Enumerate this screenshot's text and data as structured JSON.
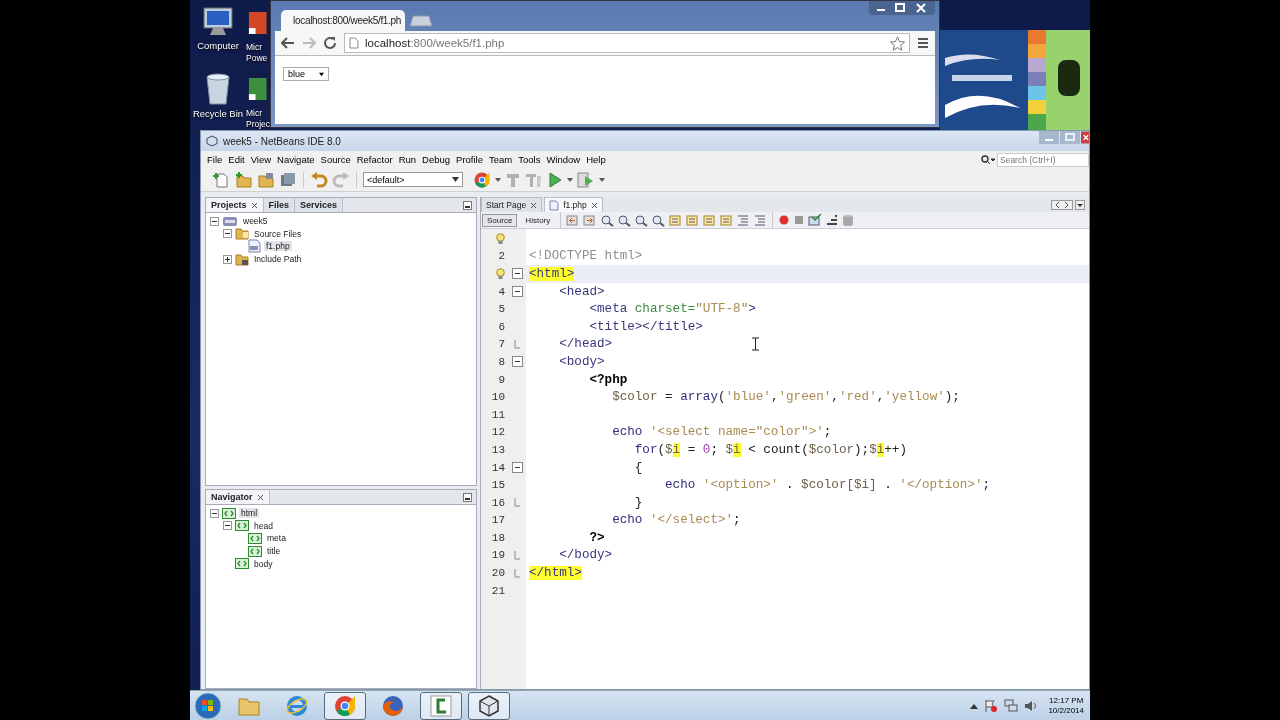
{
  "desktop": {
    "icons": [
      {
        "kind": "computer",
        "label": "Computer"
      },
      {
        "kind": "powerpoint",
        "label": "Micr Powe"
      },
      {
        "kind": "recycle",
        "label": "Recycle Bin"
      },
      {
        "kind": "project",
        "label": "Micr Projec"
      }
    ]
  },
  "browser": {
    "tab": {
      "title": "localhost:800/week5/f1.ph",
      "selected": true
    },
    "address": {
      "host": "localhost",
      "rest": ":800/week5/f1.php"
    },
    "select": {
      "value": "blue"
    }
  },
  "ide": {
    "title": "week5 - NetBeans IDE 8.0",
    "menu": [
      "File",
      "Edit",
      "View",
      "Navigate",
      "Source",
      "Refactor",
      "Run",
      "Debug",
      "Profile",
      "Team",
      "Tools",
      "Window",
      "Help"
    ],
    "search": {
      "placeholder": "Search (Ctrl+I)"
    },
    "config": "<default>",
    "projects": {
      "tabs": [
        {
          "label": "Projects",
          "selected": true
        },
        {
          "label": "Files",
          "selected": false
        },
        {
          "label": "Services",
          "selected": false
        }
      ],
      "tree": [
        {
          "label": "week5",
          "kind": "project",
          "expanded": true,
          "selected": false,
          "children": [
            {
              "label": "Source Files",
              "kind": "folder",
              "expanded": true,
              "selected": false,
              "children": [
                {
                  "label": "f1.php",
                  "kind": "file",
                  "selected": true
                }
              ]
            },
            {
              "label": "Include Path",
              "kind": "library",
              "expanded": false,
              "selected": false
            }
          ]
        }
      ]
    },
    "navigator": {
      "title": "Navigator",
      "tree": [
        {
          "label": "html",
          "kind": "tag",
          "expanded": true,
          "selected": true,
          "children": [
            {
              "label": "head",
              "kind": "tag",
              "expanded": true,
              "selected": false,
              "children": [
                {
                  "label": "meta",
                  "kind": "tag",
                  "selected": false
                },
                {
                  "label": "title",
                  "kind": "tag",
                  "selected": false
                }
              ]
            },
            {
              "label": "body",
              "kind": "tag",
              "selected": false
            }
          ]
        }
      ]
    },
    "editor": {
      "tabs": [
        {
          "label": "Start Page",
          "selected": false
        },
        {
          "label": "f1.php",
          "selected": true
        }
      ],
      "views": [
        {
          "label": "Source",
          "selected": true
        },
        {
          "label": "History",
          "selected": false
        }
      ],
      "lines": [
        {
          "hint": true
        },
        {
          "n": "2",
          "tokens": [
            {
              "kind": "doctype",
              "s": "<!DOCTYPE html>"
            }
          ]
        },
        {
          "hint": true,
          "current": true,
          "fold_open": true,
          "tokens": [
            {
              "kind": "tag",
              "s": "<html>",
              "hl": true
            }
          ]
        },
        {
          "n": "4",
          "fold_open": true,
          "tokens": [
            {
              "kind": "tag",
              "s": "    <head>"
            }
          ]
        },
        {
          "n": "5",
          "tokens": [
            {
              "kind": "tag",
              "s": "        <meta "
            },
            {
              "kind": "attr",
              "s": "charset="
            },
            {
              "kind": "str",
              "s": "\"UTF-8\""
            },
            {
              "kind": "tag",
              "s": ">"
            }
          ]
        },
        {
          "n": "6",
          "tokens": [
            {
              "kind": "tag",
              "s": "        <title></title>"
            }
          ]
        },
        {
          "n": "7",
          "fold_end": true,
          "tokens": [
            {
              "kind": "tag",
              "s": "    </head>"
            }
          ]
        },
        {
          "n": "8",
          "fold_open": true,
          "tokens": [
            {
              "kind": "tag",
              "s": "    <body>"
            }
          ]
        },
        {
          "n": "9",
          "tokens": [
            {
              "kind": "php",
              "s": "        <?php"
            }
          ]
        },
        {
          "n": "10",
          "tokens": [
            {
              "kind": "var",
              "s": "           $color"
            },
            {
              "kind": "plain",
              "s": " = "
            },
            {
              "kind": "kw",
              "s": "array"
            },
            {
              "kind": "plain",
              "s": "("
            },
            {
              "kind": "str",
              "s": "'blue'"
            },
            {
              "kind": "plain",
              "s": ","
            },
            {
              "kind": "str",
              "s": "'green'"
            },
            {
              "kind": "plain",
              "s": ","
            },
            {
              "kind": "str",
              "s": "'red'"
            },
            {
              "kind": "plain",
              "s": ","
            },
            {
              "kind": "str",
              "s": "'yellow'"
            },
            {
              "kind": "plain",
              "s": ");"
            }
          ]
        },
        {
          "n": "11"
        },
        {
          "n": "12",
          "tokens": [
            {
              "kind": "kw",
              "s": "           echo "
            },
            {
              "kind": "str",
              "s": "'<select name=\"color\">'"
            },
            {
              "kind": "plain",
              "s": ";"
            }
          ]
        },
        {
          "n": "13",
          "tokens": [
            {
              "kind": "kw",
              "s": "              for"
            },
            {
              "kind": "plain",
              "s": "("
            },
            {
              "kind": "var",
              "s": "$"
            },
            {
              "kind": "var",
              "s": "i",
              "hl": true
            },
            {
              "kind": "plain",
              "s": " = "
            },
            {
              "kind": "num",
              "s": "0"
            },
            {
              "kind": "plain",
              "s": "; "
            },
            {
              "kind": "var",
              "s": "$"
            },
            {
              "kind": "var",
              "s": "i",
              "hl": true
            },
            {
              "kind": "plain",
              "s": " < count("
            },
            {
              "kind": "var",
              "s": "$color"
            },
            {
              "kind": "plain",
              "s": ");"
            },
            {
              "kind": "var",
              "s": "$"
            },
            {
              "kind": "var",
              "s": "i",
              "hl": true
            },
            {
              "kind": "plain",
              "s": "++)"
            }
          ]
        },
        {
          "n": "14",
          "fold_open": true,
          "tokens": [
            {
              "kind": "plain",
              "s": "              {"
            }
          ]
        },
        {
          "n": "15",
          "tokens": [
            {
              "kind": "kw",
              "s": "                  echo "
            },
            {
              "kind": "str",
              "s": "'<option>'"
            },
            {
              "kind": "plain",
              "s": " . "
            },
            {
              "kind": "var",
              "s": "$color[$i]"
            },
            {
              "kind": "plain",
              "s": " . "
            },
            {
              "kind": "str",
              "s": "'</option>'"
            },
            {
              "kind": "plain",
              "s": ";"
            }
          ]
        },
        {
          "n": "16",
          "fold_end": true,
          "tokens": [
            {
              "kind": "plain",
              "s": "              }"
            }
          ]
        },
        {
          "n": "17",
          "tokens": [
            {
              "kind": "kw",
              "s": "           echo "
            },
            {
              "kind": "str",
              "s": "'</select>'"
            },
            {
              "kind": "plain",
              "s": ";"
            }
          ]
        },
        {
          "n": "18",
          "tokens": [
            {
              "kind": "php",
              "s": "        ?>"
            }
          ]
        },
        {
          "n": "19",
          "fold_end": true,
          "tokens": [
            {
              "kind": "tag",
              "s": "    </body>"
            }
          ]
        },
        {
          "n": "20",
          "fold_end": true,
          "tokens": [
            {
              "kind": "tag",
              "s": "</html>",
              "hl": true
            }
          ]
        },
        {
          "n": "21"
        }
      ]
    }
  },
  "taskbar": {
    "apps": [
      {
        "kind": "folder",
        "running": false
      },
      {
        "kind": "ie",
        "running": false
      },
      {
        "kind": "chrome",
        "running": true
      },
      {
        "kind": "firefox",
        "running": false
      },
      {
        "kind": "camtasia",
        "running": true
      },
      {
        "kind": "cube",
        "running": true
      }
    ],
    "time": "12:17 PM",
    "date": "10/2/2014"
  }
}
